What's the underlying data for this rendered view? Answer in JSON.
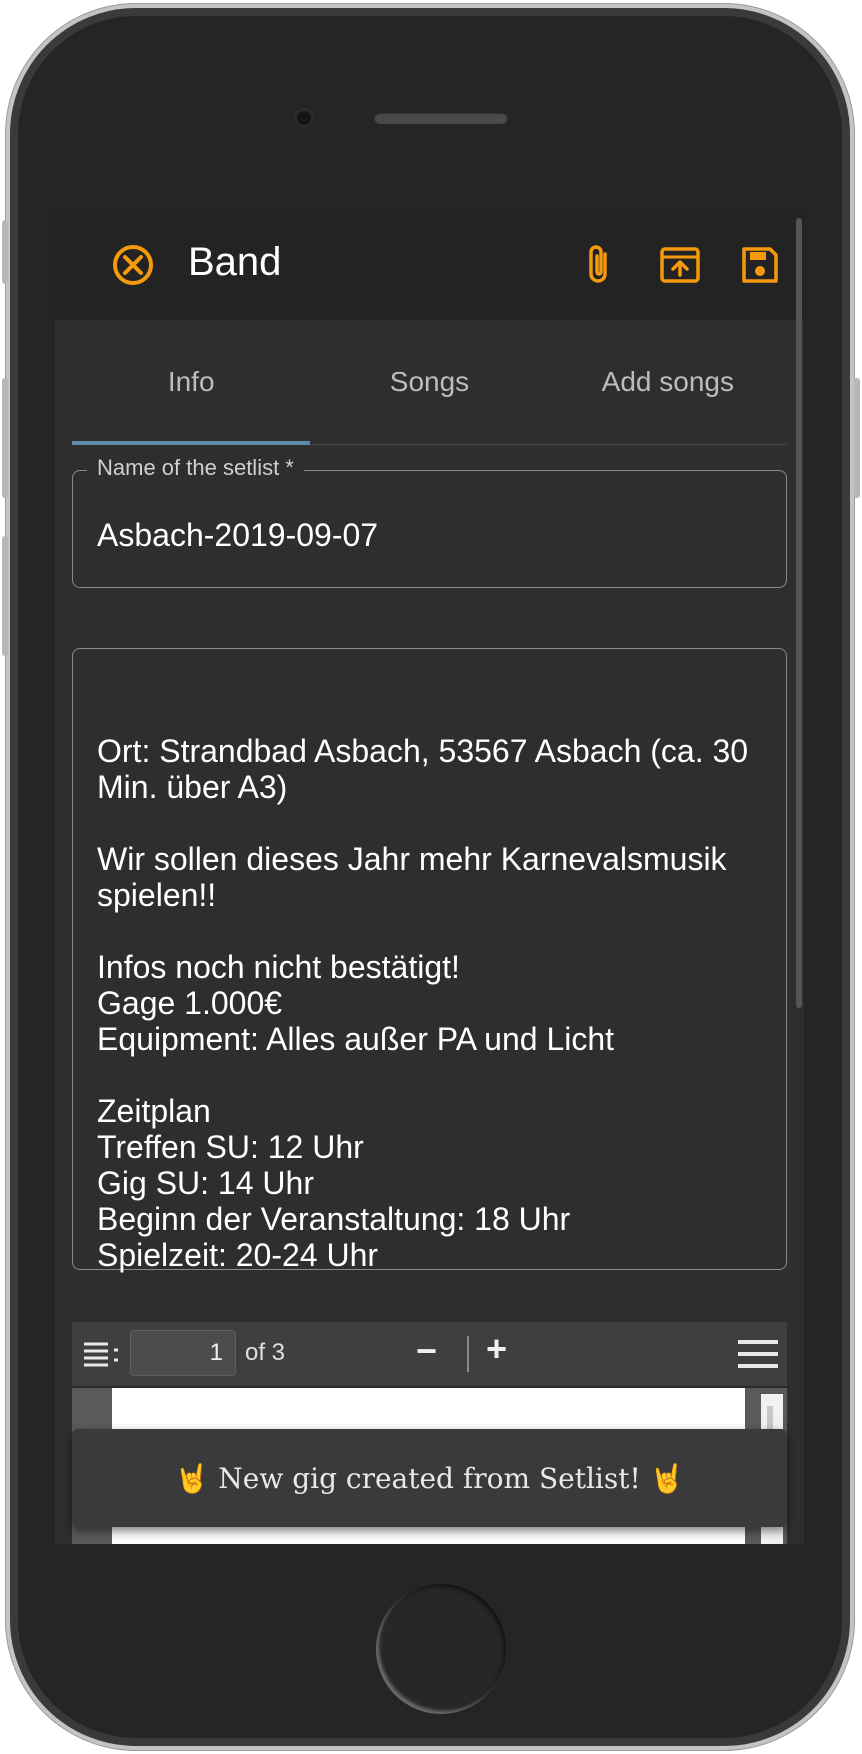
{
  "colors": {
    "accent": "#f59a0d",
    "tab_indicator": "#5e8aa6",
    "surface": "#2e2e2e",
    "appbar": "#232323"
  },
  "appbar": {
    "title": "Band",
    "icons": [
      "close-circle-icon",
      "attach-icon",
      "upload-icon",
      "save-icon"
    ]
  },
  "tabs": [
    {
      "label": "Info",
      "active": true
    },
    {
      "label": "Songs",
      "active": false
    },
    {
      "label": "Add songs",
      "active": false
    }
  ],
  "setlist_name": {
    "label": "Name of the setlist *",
    "value": "Asbach-2019-09-07"
  },
  "notes": {
    "lines": [
      "",
      "Ort: Strandbad Asbach, 53567 Asbach (ca. 30",
      "Min. über A3)",
      "",
      "Wir sollen dieses Jahr mehr Karnevalsmusik",
      "spielen!!",
      "",
      "Infos noch nicht bestätigt!",
      "Gage 1.000€",
      "Equipment: Alles außer PA und Licht",
      "",
      "Zeitplan",
      "Treffen SU: 12 Uhr",
      "Gig SU: 14 Uhr",
      "Beginn der Veranstaltung: 18 Uhr",
      "Spielzeit: 20-24 Uhr"
    ]
  },
  "pdf_viewer": {
    "page": "1",
    "of_label": "of 3",
    "zoom_out": "−",
    "zoom_in": "+"
  },
  "toast": {
    "message": "🤘 New gig created from Setlist! 🤘"
  }
}
